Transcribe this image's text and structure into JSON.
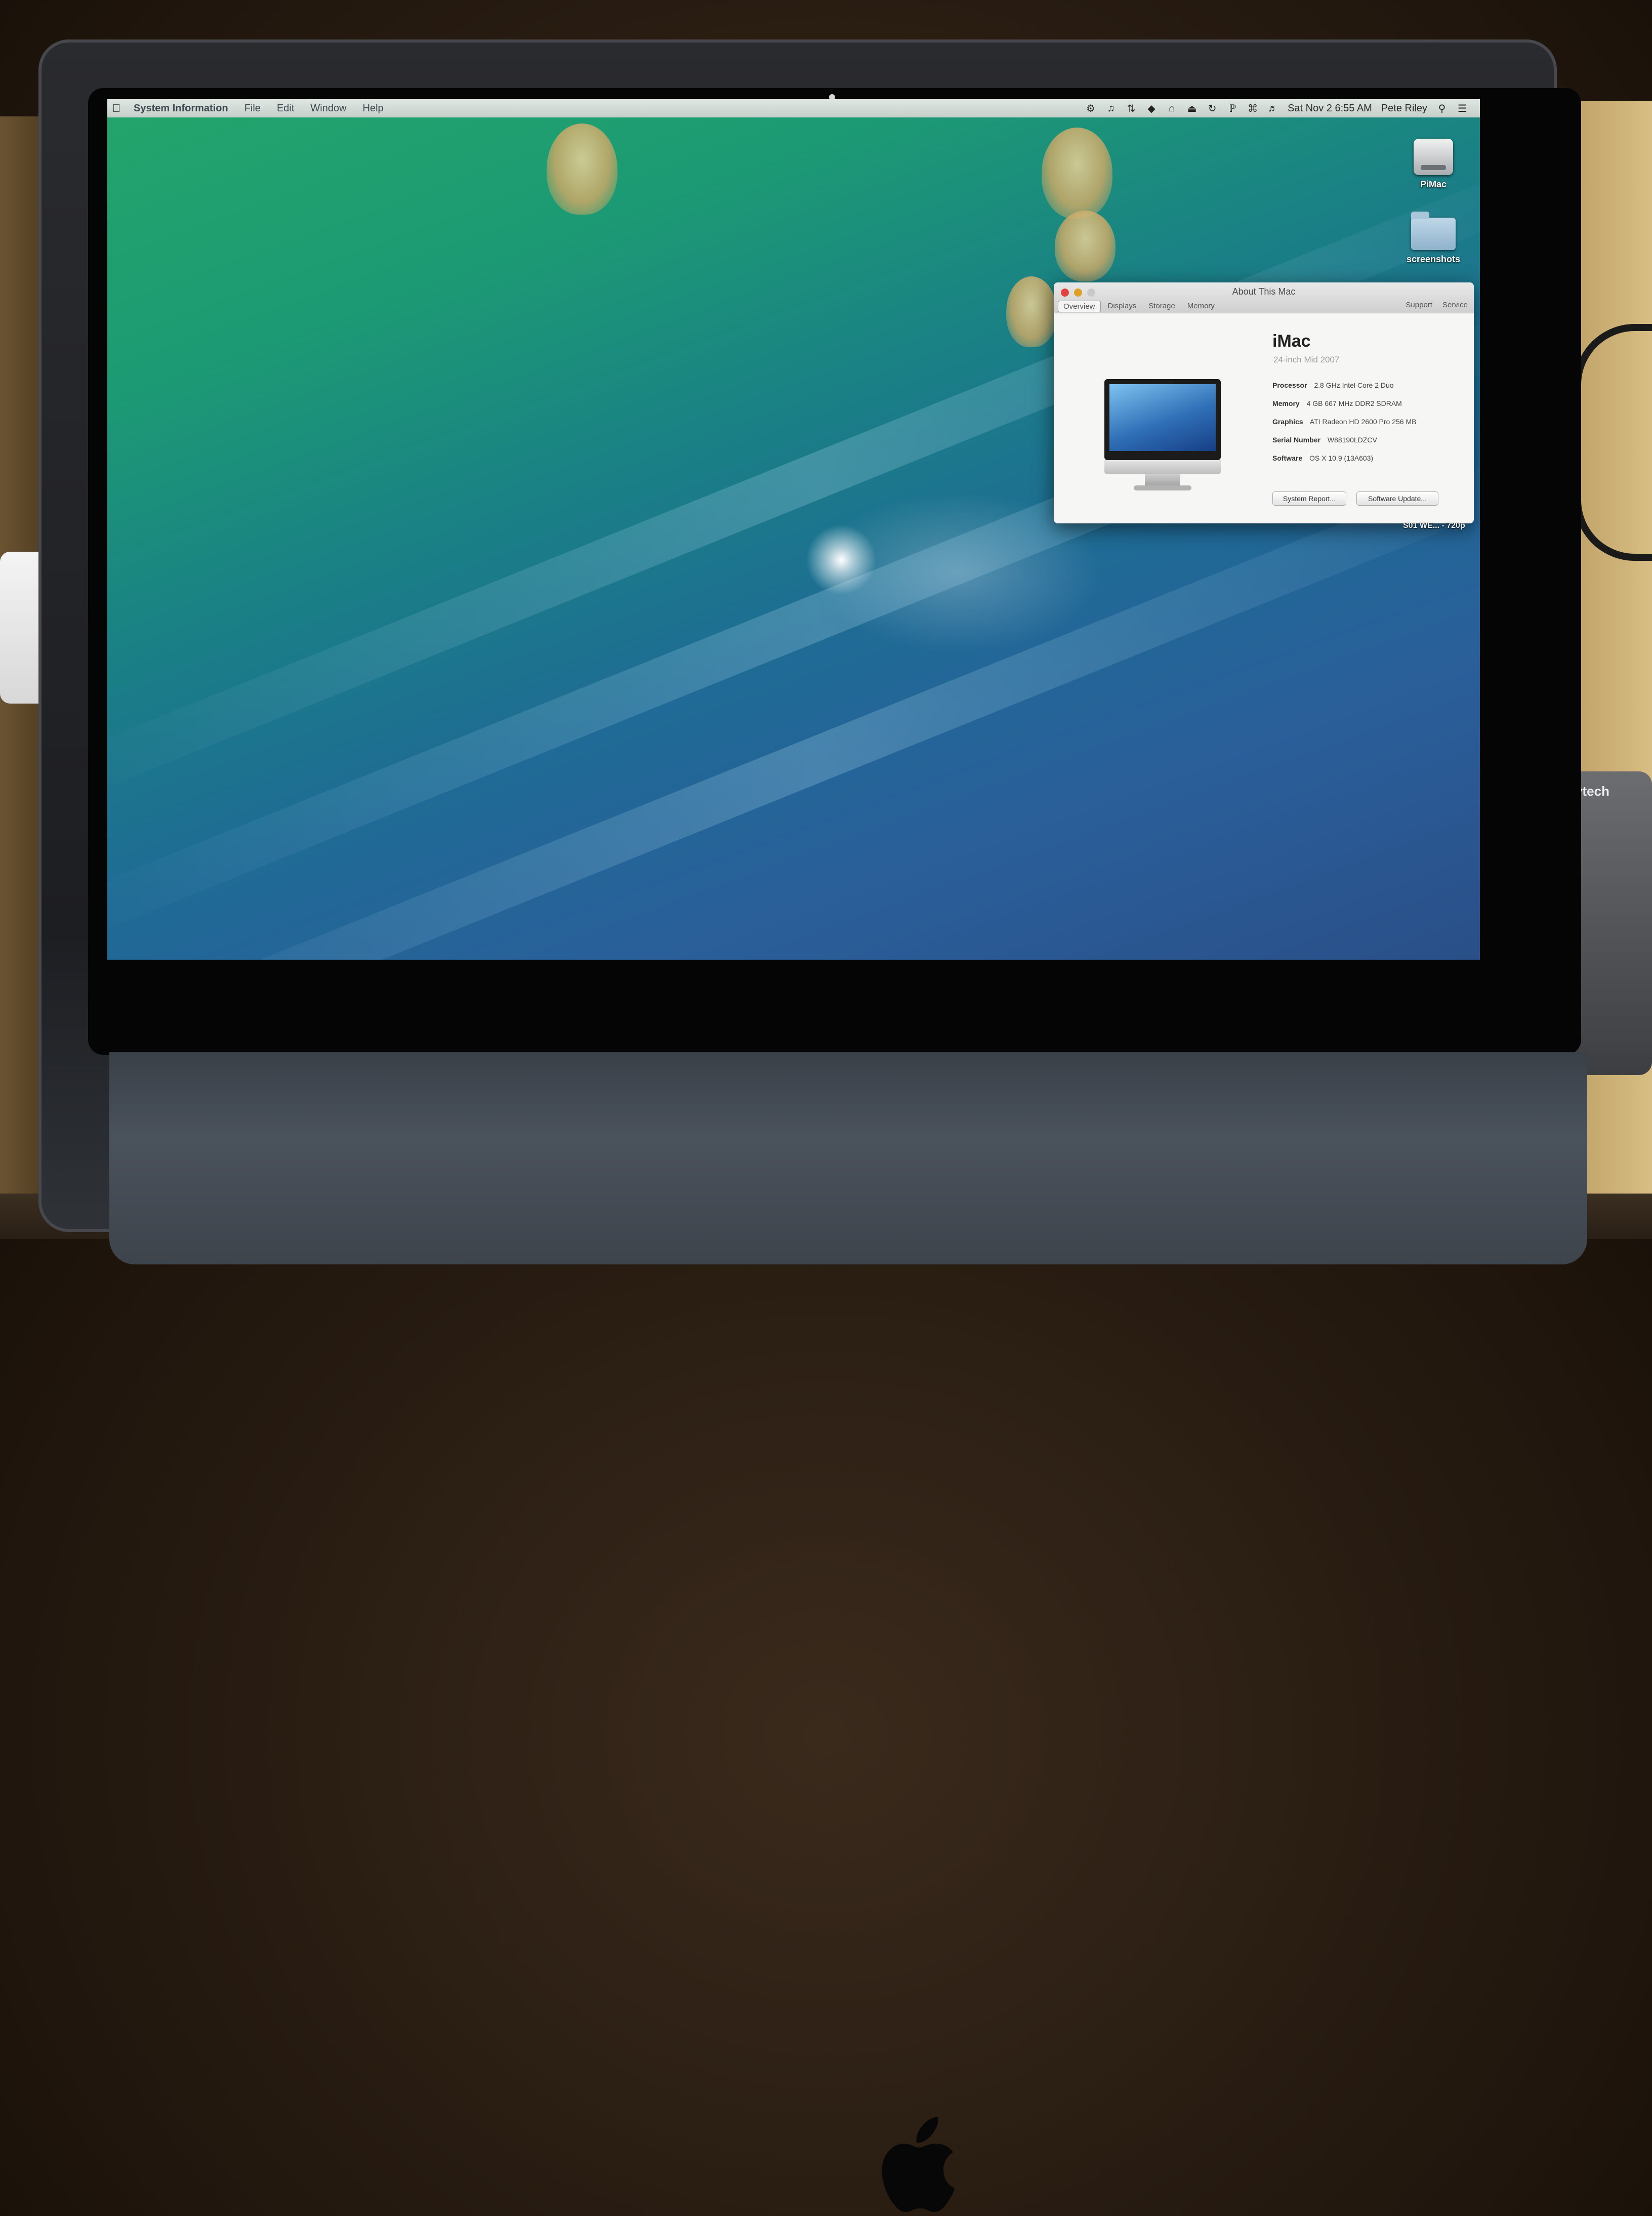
{
  "menubar": {
    "app_name": "System Information",
    "menus": [
      "File",
      "Edit",
      "Window",
      "Help"
    ],
    "clock": "Sat Nov 2  6:55 AM",
    "user": "Pete Riley"
  },
  "desktop": {
    "icons": [
      {
        "label": "PiMac",
        "icon": "hard-drive-icon"
      },
      {
        "label": "screenshots",
        "icon": "folder-icon"
      }
    ],
    "caption": "S01 WE... - 720p"
  },
  "about_window": {
    "title": "About This Mac",
    "tabs": [
      "Overview",
      "Displays",
      "Storage",
      "Memory"
    ],
    "active_tab": "Overview",
    "links": [
      "Support",
      "Service"
    ],
    "model_name": "iMac",
    "model_sub": "24-inch Mid 2007",
    "specs": [
      {
        "key": "Processor",
        "value": "2.8 GHz Intel Core 2 Duo"
      },
      {
        "key": "Memory",
        "value": "4 GB 667 MHz DDR2 SDRAM"
      },
      {
        "key": "Graphics",
        "value": "ATI Radeon HD 2600 Pro 256 MB"
      },
      {
        "key": "Serial Number",
        "value": "W88190LDZCV"
      },
      {
        "key": "Software",
        "value": "OS X 10.9 (13A603)"
      }
    ],
    "buttons": {
      "system_report": "System Report...",
      "software_update": "Software Update..."
    }
  },
  "props": {
    "phone_brand": "vtech"
  },
  "colors": {
    "close": "#e0443e",
    "minimize": "#dea123",
    "zoom": "#c9c9c9"
  }
}
